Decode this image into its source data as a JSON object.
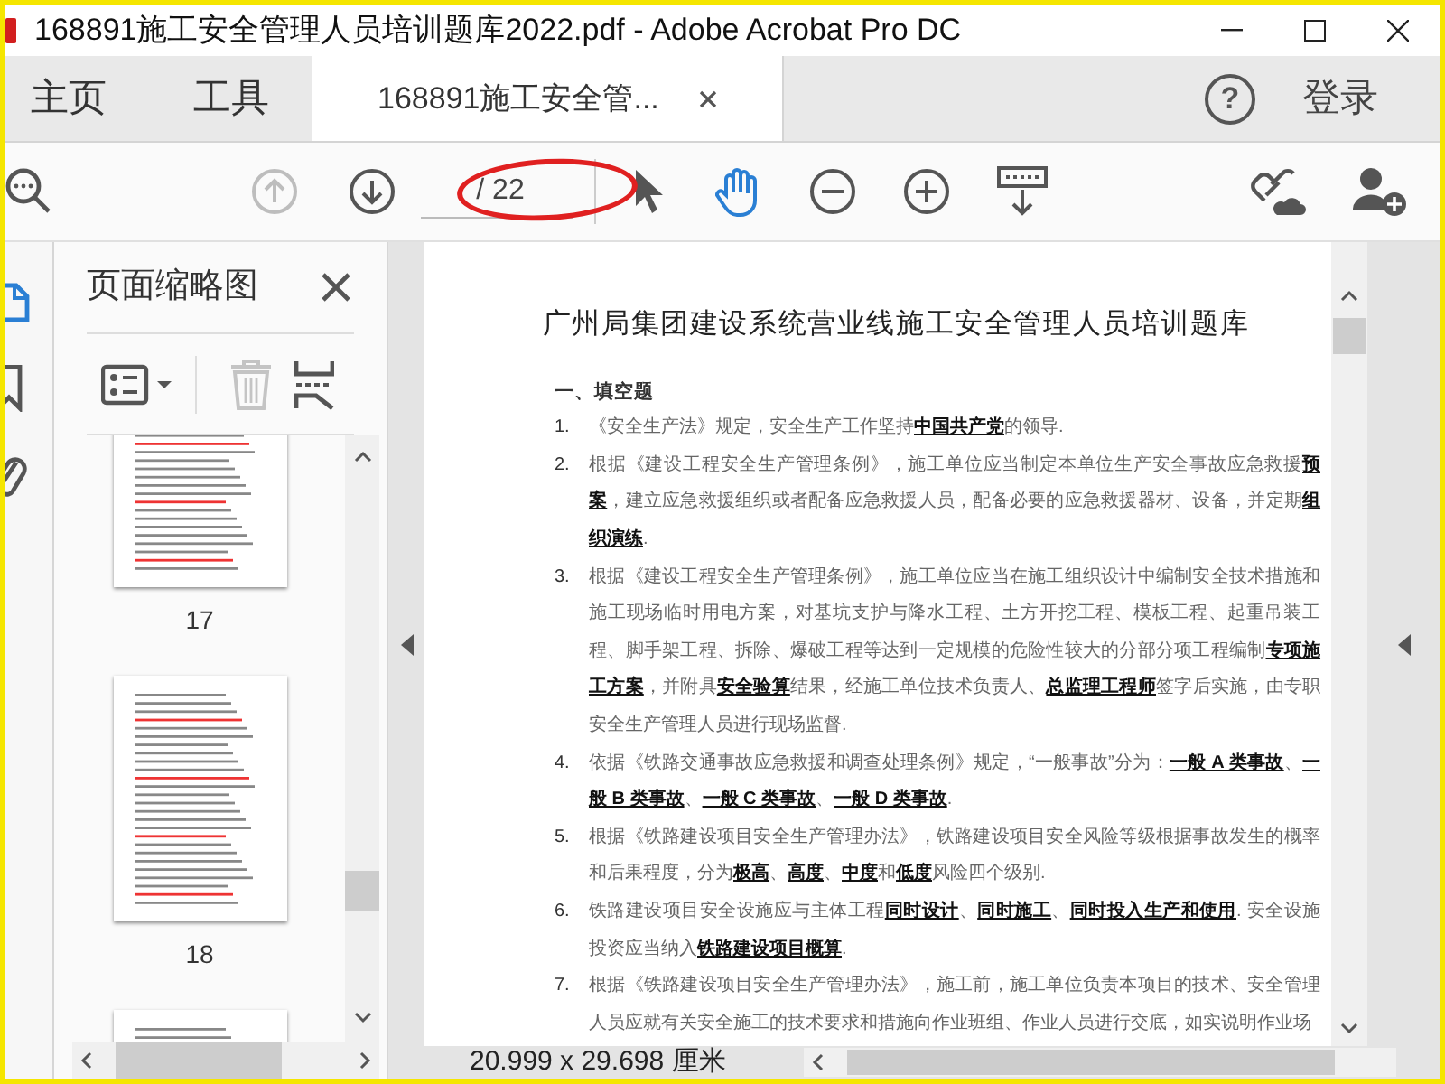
{
  "window": {
    "title": "168891施工安全管理人员培训题库2022.pdf - Adobe Acrobat Pro DC"
  },
  "tabs": [
    {
      "label": "主页",
      "selected": false
    },
    {
      "label": "工具",
      "selected": false
    },
    {
      "label": "168891施工安全管...",
      "selected": true
    }
  ],
  "login": "登录",
  "help_glyph": "?",
  "toolbar": [
    {
      "kind": "search",
      "selected": false,
      "disabled": false
    },
    {
      "kind": "prev",
      "selected": false,
      "disabled": true
    },
    {
      "kind": "next",
      "selected": false,
      "disabled": false
    },
    {
      "kind": "pagefield",
      "selected": false,
      "disabled": false
    },
    {
      "kind": "select",
      "selected": false,
      "disabled": false
    },
    {
      "kind": "hand",
      "selected": true,
      "disabled": false
    },
    {
      "kind": "zoomout",
      "selected": false,
      "disabled": false
    },
    {
      "kind": "zoomin",
      "selected": false,
      "disabled": false
    },
    {
      "kind": "scroll",
      "selected": false,
      "disabled": false
    }
  ],
  "page_total": "/ 22",
  "side_rail": [
    {
      "kind": "page",
      "selected": true
    },
    {
      "kind": "bookmark",
      "selected": false
    },
    {
      "kind": "attachment",
      "selected": false
    }
  ],
  "thumbnail_panel": {
    "title": "页面缩略图",
    "tools": [
      {
        "kind": "options",
        "disabled": false
      },
      {
        "kind": "delete",
        "disabled": true
      },
      {
        "kind": "extract",
        "disabled": false
      }
    ],
    "thumbnails": [
      {
        "kind": "page",
        "label": "17"
      },
      {
        "kind": "page",
        "label": "18"
      },
      {
        "kind": "page"
      }
    ]
  },
  "document": {
    "title": "广州局集团建设系统营业线施工安全管理人员培训题库",
    "section": "一、填空题",
    "items": [
      {
        "number": "1.",
        "text": "《安全生产法》规定，安全生产工作坚持**中国共产党**的领导."
      },
      {
        "number": "2.",
        "text": "根据《建设工程安全生产管理条例》，施工单位应当制定本单位生产安全事故应急救援**预案**，建立应急救援组织或者配备应急救援人员，配备必要的应急救援器材、设备，并定期**组织演练**."
      },
      {
        "number": "3.",
        "text": "根据《建设工程安全生产管理条例》，施工单位应当在施工组织设计中编制安全技术措施和施工现场临时用电方案，对基坑支护与降水工程、土方开挖工程、模板工程、起重吊装工程、脚手架工程、拆除、爆破工程等达到一定规模的危险性较大的分部分项工程编制**专项施工方案**，并附具**安全验算**结果，经施工单位技术负责人、**总监理工程师**签字后实施，由专职安全生产管理人员进行现场监督."
      },
      {
        "number": "4.",
        "text": "依据《铁路交通事故应急救援和调查处理条例》规定，“一般事故”分为：**一般 A 类事故**、**一般 B 类事故**、**一般 C 类事故**、**一般 D 类事故**."
      },
      {
        "number": "5.",
        "text": "根据《铁路建设项目安全生产管理办法》，铁路建设项目安全风险等级根据事故发生的概率和后果程度，分为**极高**、**高度**、**中度**和**低度**风险四个级别."
      },
      {
        "number": "6.",
        "text": "铁路建设项目安全设施应与主体工程**同时设计**、**同时施工**、**同时投入生产和使用**. 安全设施投资应当纳入**铁路建设项目概算**."
      },
      {
        "number": "7.",
        "text": "根据《铁路建设项目安全生产管理办法》，施工前，施工单位负责本项目的技术、安全管理人员应就有关安全施工的技术要求和措施向作业班组、作业人员进行交底，如实说明作业场"
      }
    ]
  },
  "status": "20.999 x 29.698 厘米"
}
